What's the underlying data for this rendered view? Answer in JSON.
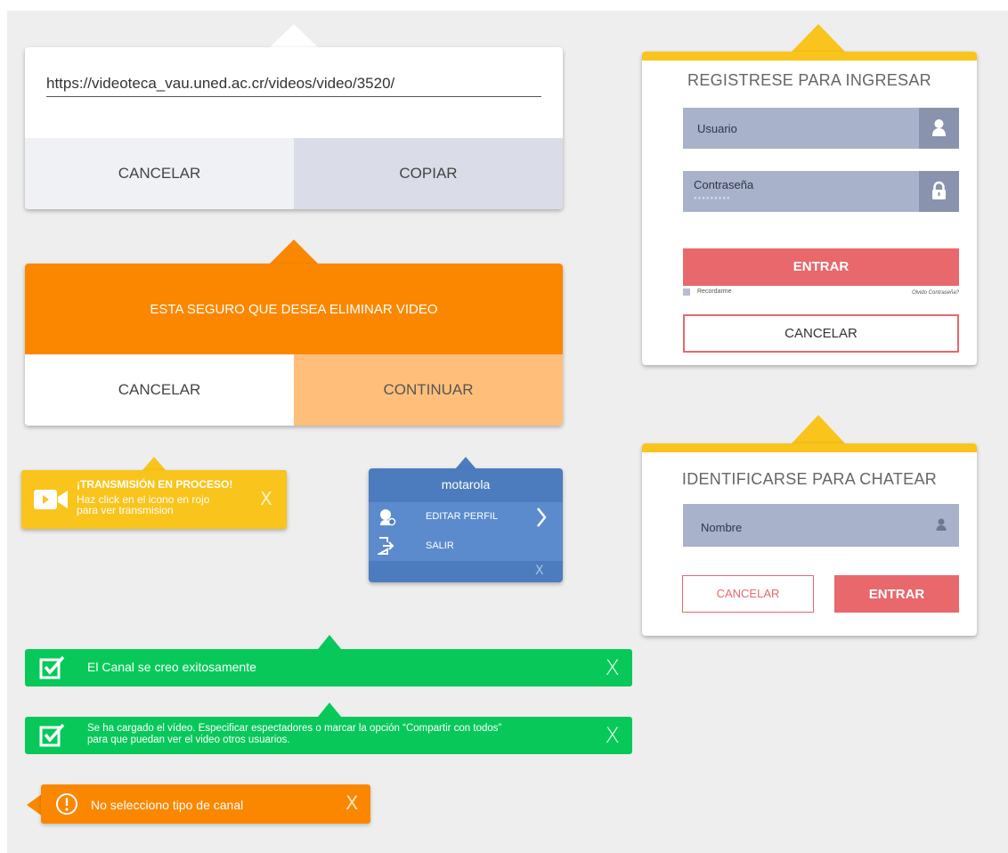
{
  "share": {
    "url": "https://videoteca_vau.uned.ac.cr/videos/video/3520/",
    "cancel_label": "CANCELAR",
    "copy_label": "COPIAR"
  },
  "delete_confirm": {
    "message": "ESTA SEGURO QUE DESEA ELIMINAR VIDEO",
    "cancel_label": "CANCELAR",
    "continue_label": "CONTINUAR"
  },
  "login": {
    "title": "REGISTRESE PARA INGRESAR",
    "user_label": "Usuario",
    "password_label": "Contraseña",
    "password_value": "●●●●●●●●●",
    "enter_label": "ENTRAR",
    "remember_label": "Recordarme",
    "forgot_label": "Olvido Contraseña?",
    "cancel_label": "CANCELAR"
  },
  "chat_login": {
    "title": "IDENTIFICARSE PARA CHATEAR",
    "name_label": "Nombre",
    "cancel_label": "CANCELAR",
    "enter_label": "ENTRAR"
  },
  "live_tooltip": {
    "title": "¡TRANSMISIÓN EN PROCESO!",
    "line1": "Haz click en el icono en rojo",
    "line2": "para ver transmision",
    "close": "X"
  },
  "user_menu": {
    "username": "motarola",
    "edit_profile": "EDITAR PERFIL",
    "logout": "SALIR",
    "close": "X"
  },
  "alerts": {
    "channel_created": "El Canal se creo exitosamente",
    "video_uploaded_line1": "Se ha cargado el vídeo. Especificar espectadores o marcar la opción “Compartir con todos”",
    "video_uploaded_line2": "para que puedan ver el video otros usuarios.",
    "channel_type_error": "No selecciono tipo de canal",
    "close": "X"
  },
  "colors": {
    "orange": "#fb8700",
    "orange_light": "#ffbf7b",
    "yellow": "#f9c41c",
    "green": "#08c85a",
    "blue": "#4d7cbe",
    "red": "#e8686b",
    "field": "#a9b2cb"
  }
}
